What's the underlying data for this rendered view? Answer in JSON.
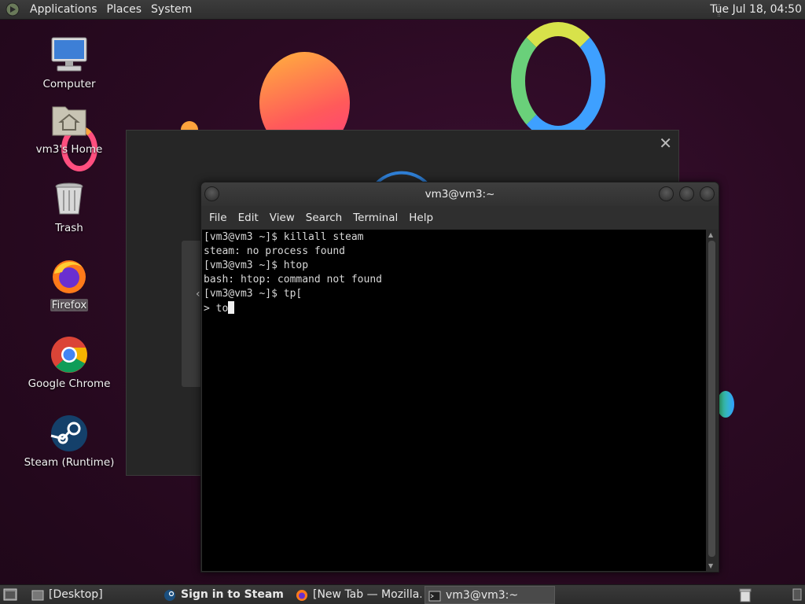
{
  "top_panel": {
    "menus": [
      "Applications",
      "Places",
      "System"
    ],
    "clock": "Tue Jul 18, 04:50"
  },
  "desktop": {
    "icons": [
      {
        "label": "Computer",
        "icon": "computer-icon"
      },
      {
        "label": "vm3's Home",
        "icon": "home-folder-icon"
      },
      {
        "label": "Trash",
        "icon": "trash-icon"
      },
      {
        "label": "Firefox",
        "icon": "firefox-icon",
        "selected": true
      },
      {
        "label": "Google Chrome",
        "icon": "chrome-icon"
      },
      {
        "label": "Steam (Runtime)",
        "icon": "steam-icon"
      }
    ]
  },
  "background_window": {
    "close_glyph": "✕"
  },
  "terminal": {
    "title": "vm3@vm3:~",
    "menu": [
      "File",
      "Edit",
      "View",
      "Search",
      "Terminal",
      "Help"
    ],
    "lines": [
      "[vm3@vm3 ~]$ killall steam",
      "steam: no process found",
      "[vm3@vm3 ~]$ htop",
      "bash: htop: command not found",
      "[vm3@vm3 ~]$ tp[",
      "> to"
    ]
  },
  "taskbar": {
    "tasks": [
      {
        "label": "[Desktop]",
        "icon": "desktop-icon"
      },
      {
        "label": "Sign in to Steam",
        "icon": "steam-icon",
        "bold": true
      },
      {
        "label": "[New Tab — Mozilla…",
        "icon": "firefox-icon"
      },
      {
        "label": "vm3@vm3:~",
        "icon": "terminal-icon",
        "active": true
      }
    ]
  },
  "colors": {
    "wallpaper": "#2a0a22",
    "terminal_bg": "#000000",
    "panel": "#333333"
  }
}
